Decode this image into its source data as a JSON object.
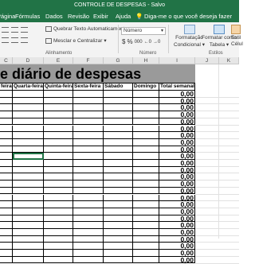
{
  "titlebar": {
    "title": "CONTROLE DE DESPESAS  -  Salvo"
  },
  "menu": [
    "Página",
    "Fórmulas",
    "Dados",
    "Revisão",
    "Exibir",
    "Ajuda"
  ],
  "tellme": {
    "placeholder": "Diga-me o que você deseja fazer",
    "icon": "lightbulb-icon"
  },
  "ribbon": {
    "wrap_text": "Quebrar Texto Automaticamente",
    "merge_center": "Mesclar e Centralizar",
    "merge_dropdown": "▾",
    "number_format": "Número",
    "currency": "$",
    "percent": "%",
    "comma": "000",
    "group_alignment": "Alinhamento",
    "group_number": "Número",
    "group_styles": "Estilos",
    "cond_format_1": "Formatação",
    "cond_format_2": "Condicional ▾",
    "format_table_1": "Formatar como",
    "format_table_2": "Tabela ▾",
    "cell_styles_1": "Estil",
    "cell_styles_2": "Célul"
  },
  "columns": [
    "C",
    "D",
    "E",
    "F",
    "G",
    "H",
    "I",
    "J",
    "K"
  ],
  "sheet": {
    "title": "e diário de despesas",
    "headers": [
      "feira",
      "Quarta-feira",
      "Quinta-feira",
      "Sexta-feira",
      "Sábado",
      "Domingo",
      "Total semanal"
    ],
    "totals": [
      "0,00",
      "0,00",
      "0,00",
      "0,00",
      "0,00",
      "0,00",
      "0,00",
      "0,00",
      "0,00",
      "0,00",
      "0,00",
      "0,00",
      "0,00",
      "0,00",
      "0,00",
      "0,00",
      "0,00",
      "0,00",
      "0,00",
      "0,00",
      "0,00",
      "0,00",
      "0,00",
      "0,00",
      "0,00"
    ]
  },
  "colors": {
    "excel_green": "#217346",
    "title_fill": "#9a9a9a"
  }
}
